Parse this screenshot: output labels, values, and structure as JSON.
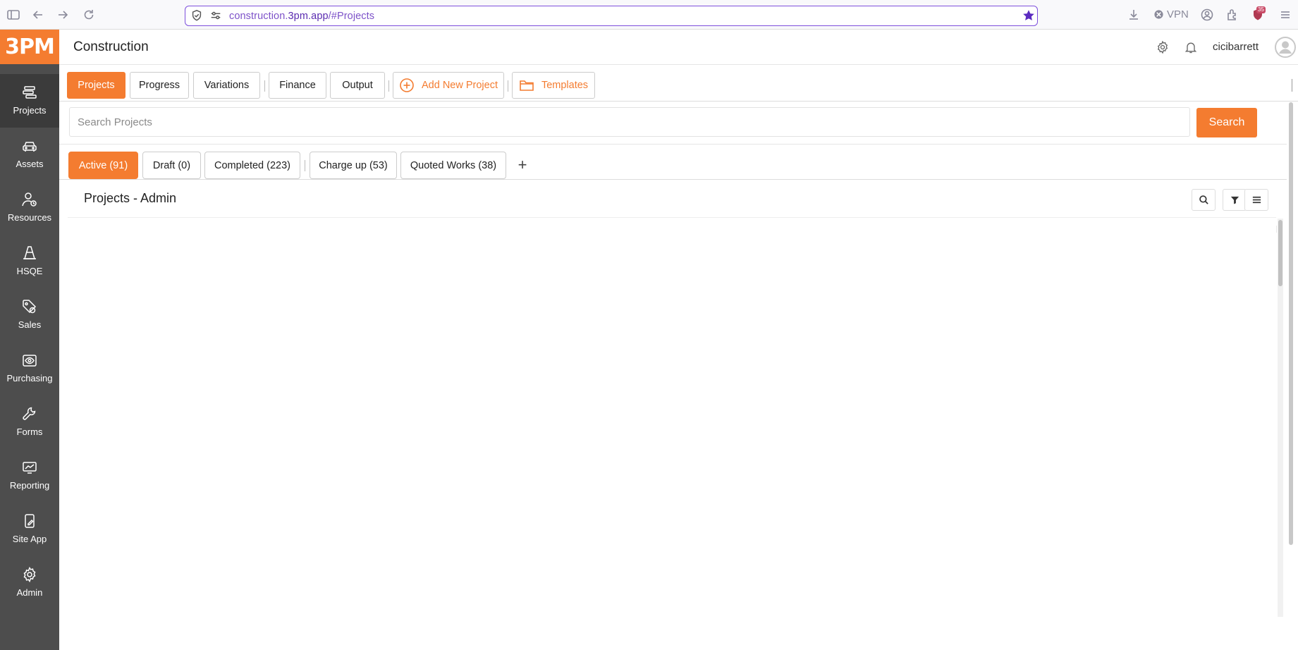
{
  "browser": {
    "url_prefix": "construction.",
    "url_host": "3pm.app",
    "url_path": "/#Projects",
    "vpn_label": "VPN",
    "extension_badge": "35"
  },
  "sidebar": {
    "logo": "3PM",
    "items": [
      {
        "label": "Projects",
        "icon": "projects-icon"
      },
      {
        "label": "Assets",
        "icon": "car-icon"
      },
      {
        "label": "Resources",
        "icon": "resources-icon"
      },
      {
        "label": "HSQE",
        "icon": "cone-icon"
      },
      {
        "label": "Sales",
        "icon": "tag-icon"
      },
      {
        "label": "Purchasing",
        "icon": "eye-icon"
      },
      {
        "label": "Forms",
        "icon": "wrench-icon"
      },
      {
        "label": "Reporting",
        "icon": "chart-icon"
      },
      {
        "label": "Site App",
        "icon": "mobile-icon"
      },
      {
        "label": "Admin",
        "icon": "gear-icon"
      }
    ]
  },
  "header": {
    "title": "Construction",
    "username": "cicibarrett"
  },
  "main_tabs": {
    "projects": "Projects",
    "progress": "Progress",
    "variations": "Variations",
    "finance": "Finance",
    "output": "Output",
    "add_new_project": "Add New Project",
    "templates": "Templates"
  },
  "search": {
    "placeholder": "Search Projects",
    "value": "",
    "button": "Search"
  },
  "filter_tabs": {
    "active": "Active (91)",
    "draft": "Draft (0)",
    "completed": "Completed (223)",
    "charge_up": "Charge up (53)",
    "quoted_works": "Quoted Works (38)",
    "add": "+"
  },
  "panel": {
    "title": "Projects - Admin"
  },
  "colors": {
    "accent": "#f47c30",
    "sidebar": "#4d4d4d",
    "url_border": "#7d4fdc"
  }
}
